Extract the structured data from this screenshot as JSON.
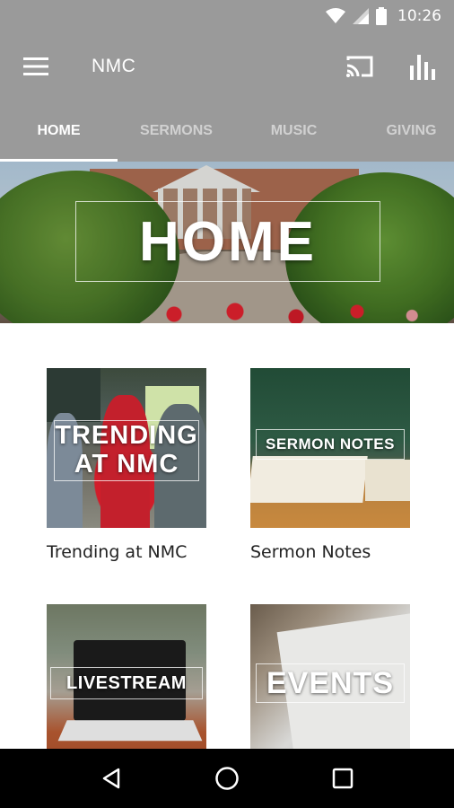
{
  "status_bar": {
    "time": "10:26",
    "icons": [
      "wifi-icon",
      "cell-signal-icon",
      "battery-icon"
    ]
  },
  "app_bar": {
    "title": "NMC",
    "menu_icon": "hamburger-menu-icon",
    "actions": [
      "cast-icon",
      "equalizer-icon"
    ]
  },
  "tabs": [
    {
      "label": "HOME",
      "active": true
    },
    {
      "label": "SERMONS",
      "active": false
    },
    {
      "label": "MUSIC",
      "active": false
    },
    {
      "label": "GIVING",
      "active": false
    }
  ],
  "hero": {
    "title": "HOME"
  },
  "cards": [
    {
      "thumb_label_line1": "TRENDING",
      "thumb_label_line2": "AT NMC",
      "caption": "Trending at NMC"
    },
    {
      "thumb_label": "SERMON NOTES",
      "caption": "Sermon Notes"
    },
    {
      "thumb_label": "LIVESTREAM",
      "caption": ""
    },
    {
      "thumb_label": "EVENTS",
      "caption": ""
    }
  ],
  "nav_bar": {
    "buttons": [
      "back-icon",
      "home-icon",
      "recents-icon"
    ]
  },
  "colors": {
    "app_bar": "#9a9a9a",
    "tab_indicator": "#ffffff",
    "nav_bar": "#000000"
  }
}
